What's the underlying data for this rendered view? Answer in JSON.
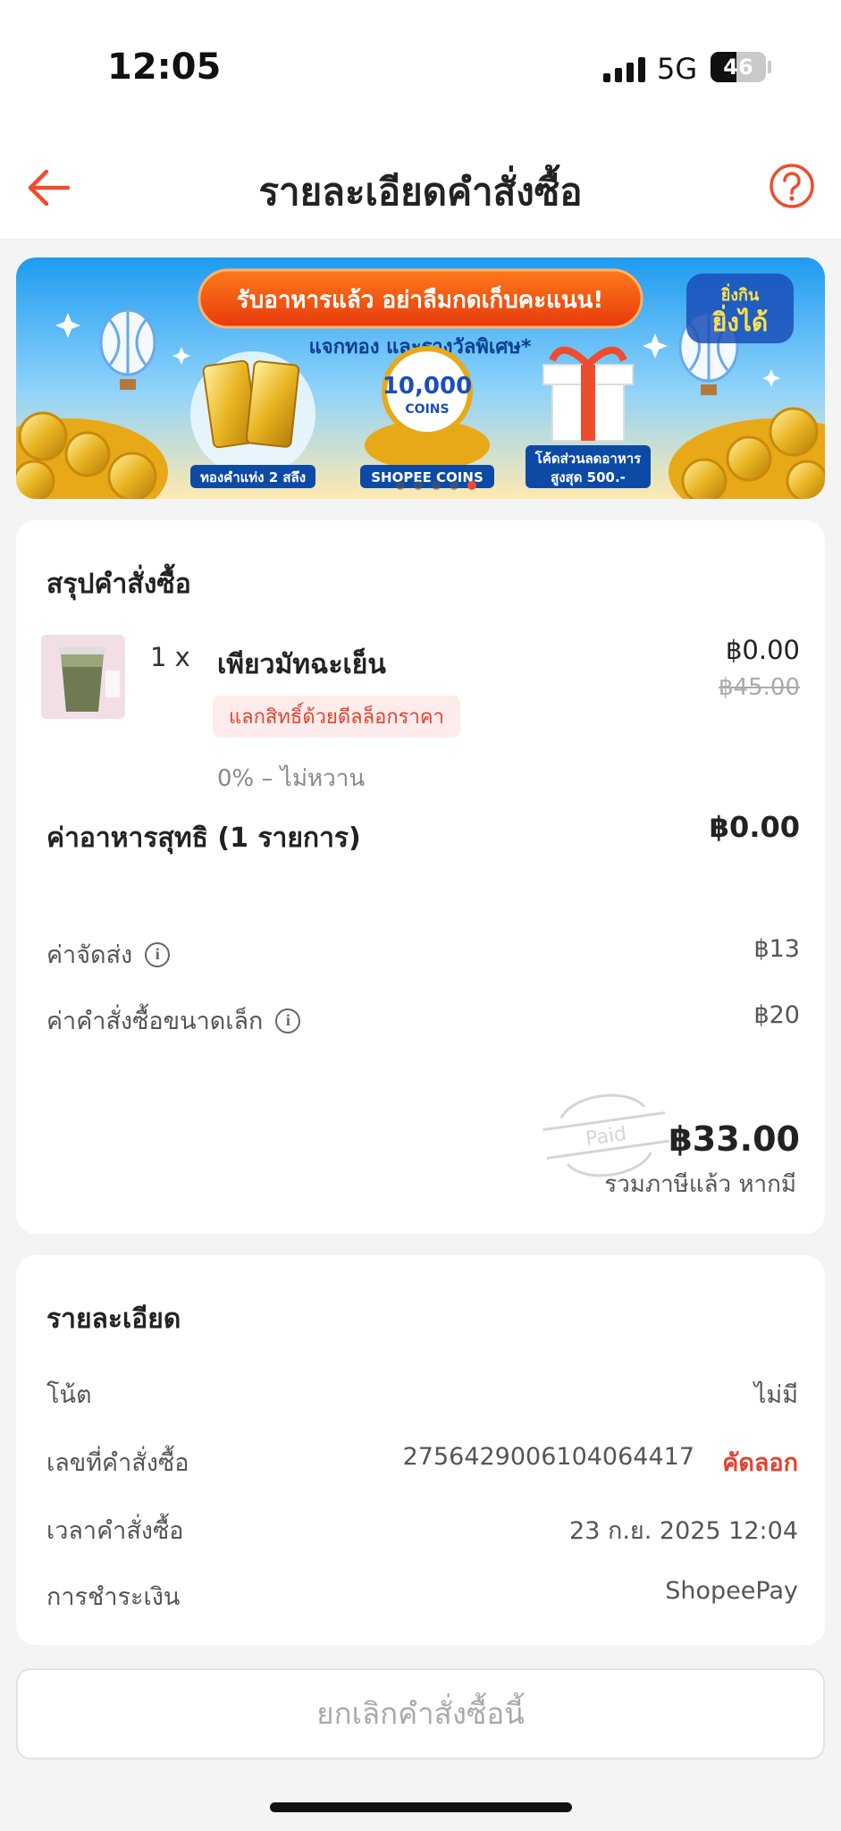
{
  "status_bar": {
    "time": "12:05",
    "network": "5G",
    "battery": "46",
    "battery_level": 0.46
  },
  "header": {
    "title": "รายละเอียดคำสั่งซื้อ",
    "back_icon": "arrow-left-icon",
    "help_icon": "question-circle-icon",
    "accent_color": "#ee4d2d"
  },
  "banner": {
    "headline": "รับอาหารแล้ว อย่าลืมกดเก็บคะแนน!",
    "subtitle": "แจกทอง และรางวัลพิเศษ*",
    "campaign_logo_line1": "ยิ่งกิน",
    "campaign_logo_line2": "ยิ่งได้",
    "prizes": [
      {
        "label": "ทองคำแท่ง 2 สลึง"
      },
      {
        "label": "SHOPEE COINS",
        "badge_top": "10,000",
        "badge_bottom": "COINS"
      },
      {
        "label_line1": "โค้ดส่วนลดอาหาร",
        "label_line2": "สูงสุด 500.-"
      }
    ]
  },
  "summary": {
    "title": "สรุปคำสั่งซื้อ",
    "item": {
      "qty": "1 x",
      "name": "เพียวมัทฉะเย็น",
      "promo_tag": "แลกสิทธิ์ด้วยดีลล็อกราคา",
      "option": "0% – ไม่หวาน",
      "price": "฿0.00",
      "original_price": "฿45.00"
    },
    "subtotal_label": "ค่าอาหารสุทธิ (1 รายการ)",
    "subtotal_value": "฿0.00",
    "fees": [
      {
        "label": "ค่าจัดส่ง",
        "value": "฿13"
      },
      {
        "label": "ค่าคำสั่งซื้อขนาดเล็ก",
        "value": "฿20"
      }
    ],
    "paid_stamp": "Paid",
    "total": "฿33.00",
    "total_note": "รวมภาษีแล้ว หากมี"
  },
  "details": {
    "title": "รายละเอียด",
    "note_label": "โน้ต",
    "note_value": "ไม่มี",
    "order_no_label": "เลขที่คำสั่งซื้อ",
    "order_no_value": "2756429006104064417",
    "copy_label": "คัดลอก",
    "order_time_label": "เวลาคำสั่งซื้อ",
    "order_time_value": "23 ก.ย. 2025 12:04",
    "payment_label": "การชำระเงิน",
    "payment_value": "ShopeePay"
  },
  "cancel_button": "ยกเลิกคำสั่งซื้อนี้"
}
